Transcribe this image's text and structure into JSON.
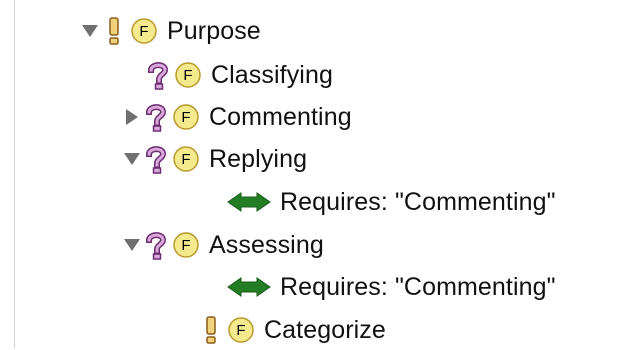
{
  "colors": {
    "feature_fill": "#f4e98d",
    "feature_stroke": "#b89b2d",
    "question_fill": "#d9a9db",
    "question_stroke": "#6d2d71",
    "exclamation_fill": "#f1d27c",
    "exclamation_stroke": "#8a5c1a",
    "constraint_green": "#237d24",
    "toggle_gray": "#6f6f6f"
  },
  "tree": {
    "purpose": {
      "label": "Purpose",
      "feature_letter": "F",
      "status_icon": "exclamation-icon",
      "expanded": true
    },
    "classifying": {
      "label": "Classifying",
      "feature_letter": "F",
      "status_icon": "question-icon"
    },
    "commenting": {
      "label": "Commenting",
      "feature_letter": "F",
      "status_icon": "question-icon",
      "expanded": false
    },
    "replying": {
      "label": "Replying",
      "feature_letter": "F",
      "status_icon": "question-icon",
      "expanded": true,
      "constraint": {
        "label": "Requires: \"Commenting\"",
        "icon": "double-arrow-icon"
      }
    },
    "assessing": {
      "label": "Assessing",
      "feature_letter": "F",
      "status_icon": "question-icon",
      "expanded": true,
      "constraint": {
        "label": "Requires: \"Commenting\"",
        "icon": "double-arrow-icon"
      }
    },
    "categorize": {
      "label": "Categorize",
      "feature_letter": "F",
      "status_icon": "exclamation-icon"
    }
  }
}
